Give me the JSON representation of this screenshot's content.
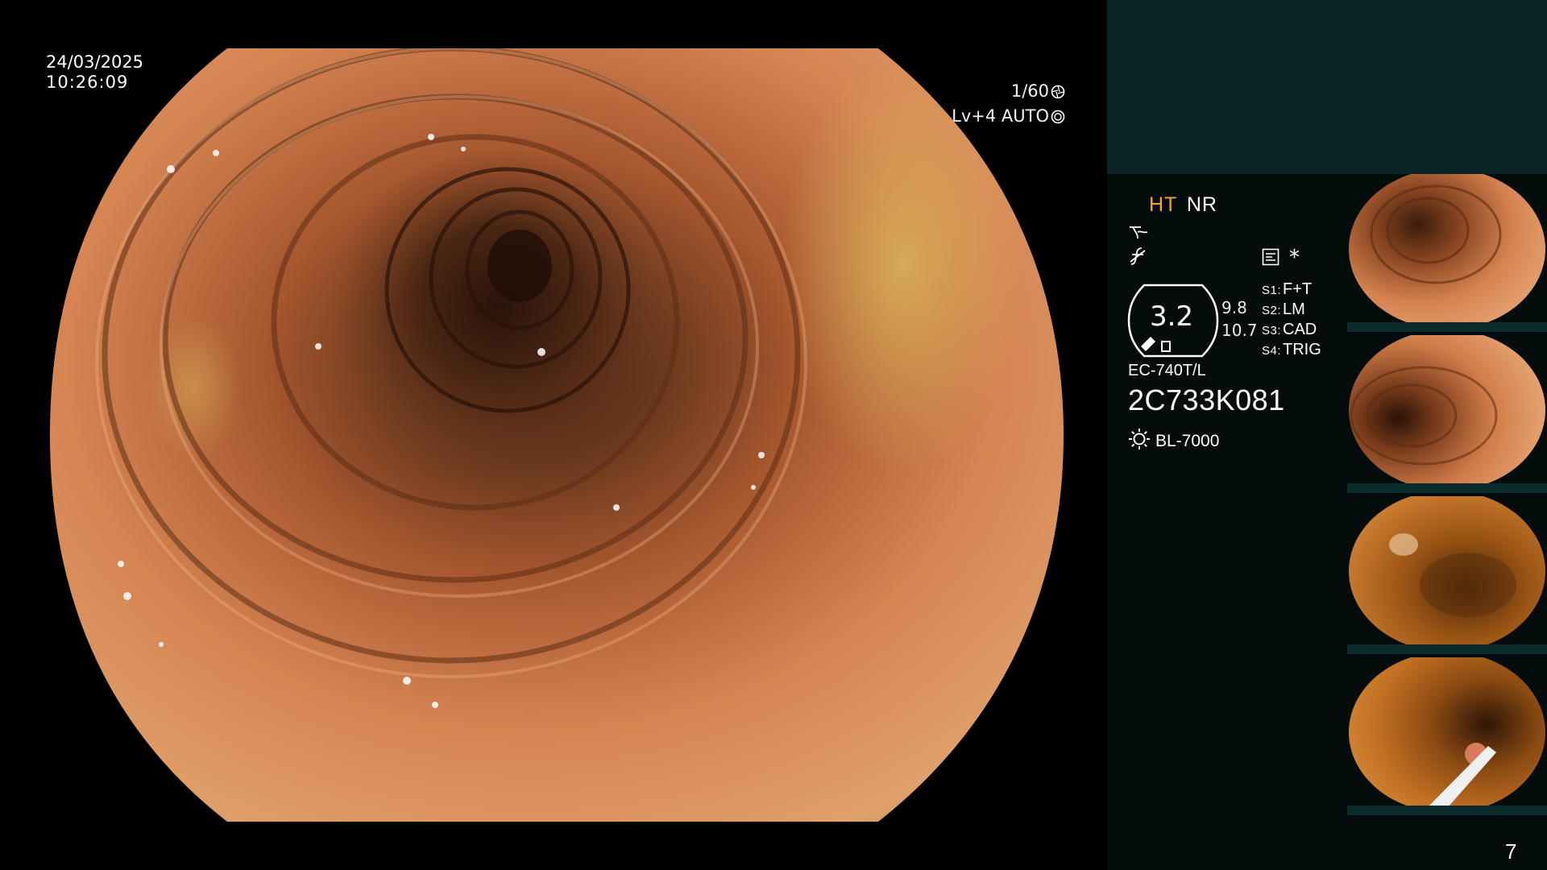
{
  "osd": {
    "date": "24/03/2025",
    "time": "10:26:09",
    "shutter": "1/60",
    "level_mode": "Lv+4 AUTO"
  },
  "info_panel": {
    "mode_ht": "HT",
    "mode_nr": "NR",
    "gauge_value": "3.2",
    "gauge_sub1": "9.8",
    "gauge_sub2": "10.7",
    "switches": [
      {
        "key": "S1:",
        "label": "F+T"
      },
      {
        "key": "S2:",
        "label": "LM"
      },
      {
        "key": "S3:",
        "label": "CAD"
      },
      {
        "key": "S4:",
        "label": "TRIG"
      }
    ],
    "scope_model": "EC-740T/L",
    "scope_serial": "2C733K081",
    "light_source": "BL-7000",
    "asterisk": "*"
  },
  "thumbnails": [
    {
      "label": "capture-1"
    },
    {
      "label": "capture-2"
    },
    {
      "label": "capture-3"
    },
    {
      "label": "capture-4"
    }
  ],
  "page_number": "7",
  "colors": {
    "panel_header": "#0a2526",
    "panel_body": "#040c0c",
    "accent_ht": "#f5a623",
    "mucosa": "#c8703d"
  },
  "icons": [
    "shutter-icon",
    "auto-iris-icon",
    "wave-icon",
    "f-slash-icon",
    "menu-icon",
    "asterisk-icon",
    "light-source-icon"
  ]
}
